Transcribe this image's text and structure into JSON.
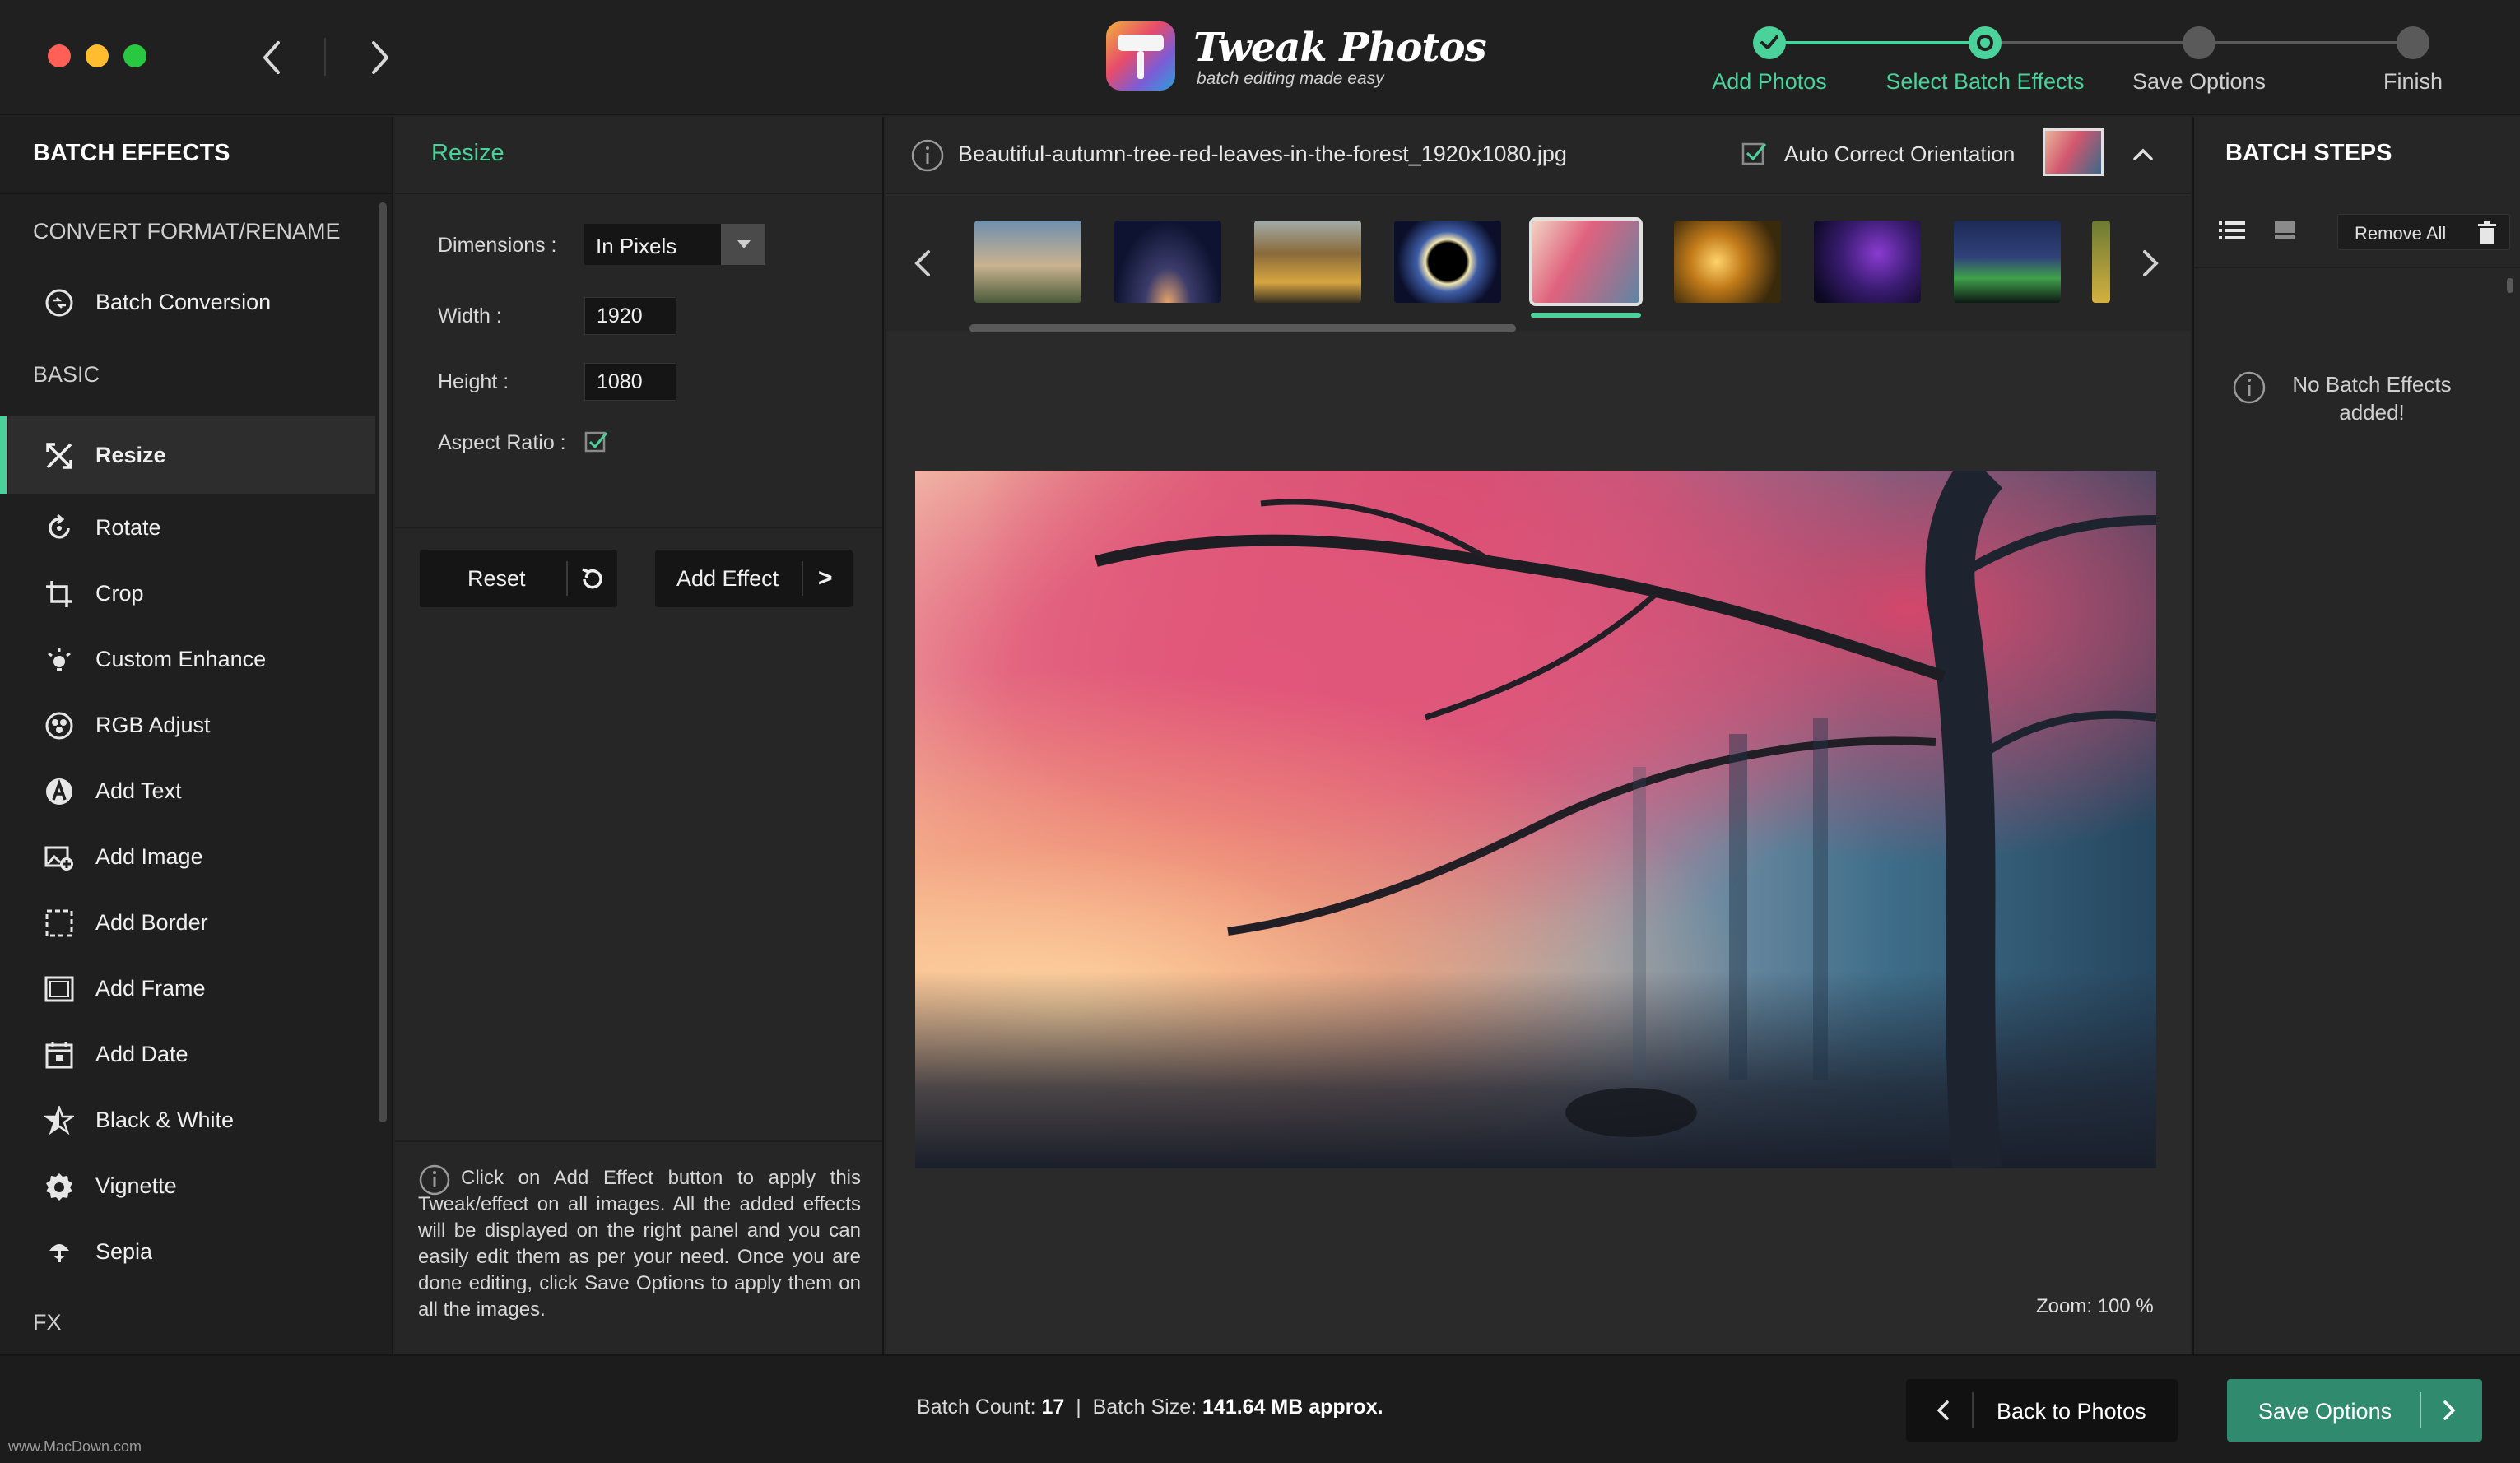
{
  "app": {
    "brand_name": "Tweak Photos",
    "brand_tagline": "batch editing made easy"
  },
  "stepper": {
    "steps": [
      {
        "label": "Add Photos",
        "state": "done"
      },
      {
        "label": "Select Batch Effects",
        "state": "current"
      },
      {
        "label": "Save Options",
        "state": "pending"
      },
      {
        "label": "Finish",
        "state": "pending"
      }
    ],
    "accent": "#4bd19a"
  },
  "sidebar": {
    "title": "BATCH EFFECTS",
    "sections": {
      "convert": "CONVERT FORMAT/RENAME",
      "basic": "BASIC",
      "fx": "FX"
    },
    "items": [
      {
        "label": "Batch Conversion",
        "icon": "convert-icon"
      },
      {
        "label": "Resize",
        "icon": "resize-icon",
        "active": true
      },
      {
        "label": "Rotate",
        "icon": "rotate-icon"
      },
      {
        "label": "Crop",
        "icon": "crop-icon"
      },
      {
        "label": "Custom Enhance",
        "icon": "enhance-icon"
      },
      {
        "label": "RGB Adjust",
        "icon": "rgb-icon"
      },
      {
        "label": "Add Text",
        "icon": "text-icon"
      },
      {
        "label": "Add Image",
        "icon": "image-icon"
      },
      {
        "label": "Add Border",
        "icon": "border-icon"
      },
      {
        "label": "Add Frame",
        "icon": "frame-icon"
      },
      {
        "label": "Add Date",
        "icon": "calendar-icon"
      },
      {
        "label": "Black & White",
        "icon": "bw-icon"
      },
      {
        "label": "Vignette",
        "icon": "vignette-icon"
      },
      {
        "label": "Sepia",
        "icon": "sepia-icon"
      }
    ]
  },
  "settings": {
    "title": "Resize",
    "dimensions_label": "Dimensions :",
    "dimensions_value": "In Pixels",
    "width_label": "Width :",
    "width_value": "1920",
    "height_label": "Height :",
    "height_value": "1080",
    "aspect_label": "Aspect Ratio :",
    "aspect_checked": true,
    "reset_label": "Reset",
    "add_effect_label": "Add Effect",
    "add_effect_arrow": ">",
    "hint": "Click on Add Effect button to apply this Tweak/effect on all images. All the added effects will be displayed on the right panel and you can easily edit them as per your need. Once you are done editing, click Save Options to apply them on all the images."
  },
  "preview": {
    "filename": "Beautiful-autumn-tree-red-leaves-in-the-forest_1920x1080.jpg",
    "auto_correct_label": "Auto Correct Orientation",
    "auto_correct_checked": true,
    "selected_thumb_index": 4,
    "zoom_label": "Zoom: 100 %"
  },
  "batch_steps": {
    "title": "BATCH STEPS",
    "remove_all_label": "Remove  All",
    "empty_message": "No Batch Effects added!"
  },
  "footer": {
    "batch_count_label": "Batch Count:",
    "batch_count_value": "17",
    "separator": "|",
    "batch_size_label": "Batch Size:",
    "batch_size_value": "141.64 MB approx.",
    "back_label": "Back to Photos",
    "save_label": "Save Options",
    "watermark": "www.MacDown.com"
  }
}
